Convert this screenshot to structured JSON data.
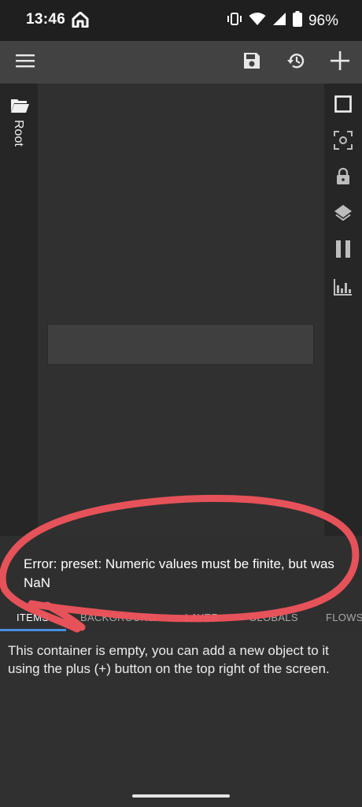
{
  "status_bar": {
    "time": "13:46",
    "battery_percent": "96%",
    "icons": [
      "home-icon",
      "vibrate-icon",
      "wifi-icon",
      "signal-icon",
      "battery-icon"
    ]
  },
  "toolbar": {
    "icons": [
      "menu-icon",
      "save-icon",
      "history-icon",
      "add-icon"
    ]
  },
  "left_rail": {
    "root_label": "Root",
    "icon": "folder-icon"
  },
  "right_rail": {
    "icons": [
      "square-icon",
      "focus-icon",
      "lock-icon",
      "layers-icon",
      "pause-icon",
      "chart-icon"
    ]
  },
  "error": {
    "message": "Error: preset: Numeric values must be finite, but was NaN"
  },
  "tabs": [
    {
      "label": "ITEMS",
      "active": true
    },
    {
      "label": "BACKGROUND",
      "active": false
    },
    {
      "label": "LAYER",
      "active": false
    },
    {
      "label": "GLOBALS",
      "active": false
    },
    {
      "label": "FLOWS",
      "active": false
    }
  ],
  "items_panel": {
    "empty_message": "This container is empty, you can add a new object to it using the plus (+) button on the top right of the screen."
  },
  "colors": {
    "accent": "#4a90e2",
    "annotation": "#f0545c",
    "toolbar": "#424242",
    "canvas": "#303030"
  }
}
